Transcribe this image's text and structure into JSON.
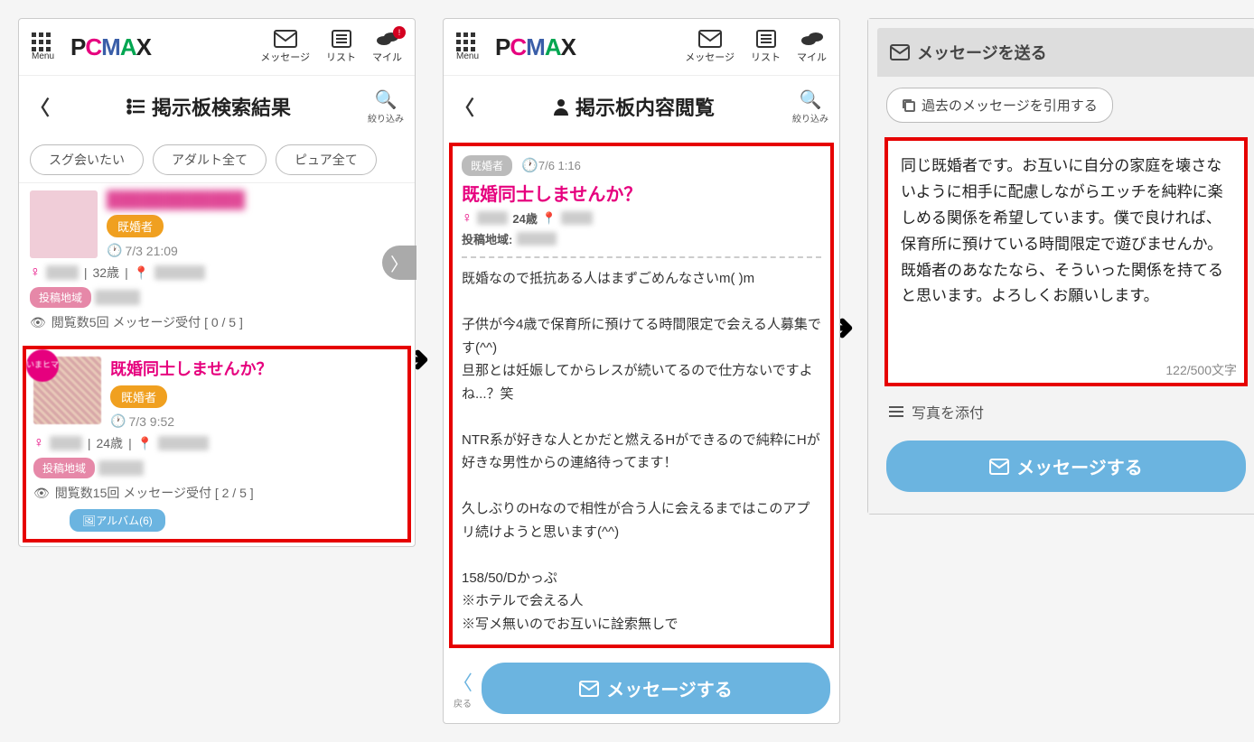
{
  "header": {
    "menu_label": "Menu",
    "brand": "PCMAX",
    "message_label": "メッセージ",
    "list_label": "リスト",
    "mile_label": "マイル",
    "badge": "!"
  },
  "panel1": {
    "title": "掲示板検索結果",
    "filter_label": "絞り込み",
    "chips": [
      "スグ会いたい",
      "アダルト全て",
      "ピュア全て"
    ],
    "posts": [
      {
        "title": "████████████",
        "tag": "既婚者",
        "time": "7/3 21:09",
        "age": "32歳",
        "region_tag": "投稿地域",
        "views": "閲覧数5回 メッセージ受付 [ 0 / 5 ]"
      },
      {
        "ima": "いまヒマ",
        "title": "既婚同士しませんか？",
        "tag": "既婚者",
        "time": "7/3 9:52",
        "age": "24歳",
        "region_tag": "投稿地域",
        "views": "閲覧数15回 メッセージ受付 [ 2 / 5 ]",
        "album": "🖼アルバム(6)"
      }
    ]
  },
  "panel2": {
    "title": "掲示板内容閲覧",
    "filter_label": "絞り込み",
    "tag_grey": "既婚者",
    "timestamp": "7/6 1:16",
    "post_title": "既婚同士しませんか？",
    "age": "24歳",
    "region_label": "投稿地域:",
    "body": "既婚なので抵抗ある人はまずごめんなさいm( )m\n\n子供が今4歳で保育所に預けてる時間限定で会える人募集です(^^)\n旦那とは妊娠してからレスが続いてるので仕方ないですよね...？笑\n\nNTR系が好きな人とかだと燃えるHができるので純粋にHが好きな男性からの連絡待ってます！\n\n久しぶりのHなので相性が合う人に会えるまではこのアプリ続けようと思います(^^)\n\n158/50/Dかっぷ\n※ホテルで会える人\n※写メ無いのでお互いに詮索無しで",
    "back_label": "戻る",
    "button": "メッセージする"
  },
  "panel3": {
    "header": "メッセージを送る",
    "quote": "過去のメッセージを引用する",
    "textarea": "同じ既婚者です。お互いに自分の家庭を壊さないように相手に配慮しながらエッチを純粋に楽しめる関係を希望しています。僕で良ければ、保育所に預けている時間限定で遊びませんか。既婚者のあなたなら、そういった関係を持てると思います。よろしくお願いします。",
    "char_count": "122/500文字",
    "attach": "写真を添付",
    "button": "メッセージする"
  }
}
